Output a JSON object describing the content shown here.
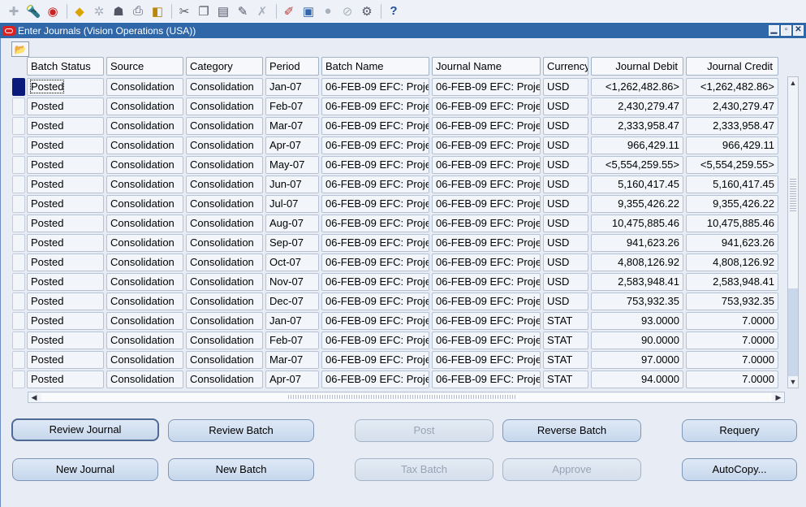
{
  "window": {
    "title": "Enter Journals (Vision Operations (USA))",
    "minimize_glyph": "▁",
    "maximize_glyph": "▫",
    "close_glyph": "✕"
  },
  "toolbar": {
    "icons": [
      "new-record-icon",
      "find-icon",
      "navigator-icon",
      "save-icon",
      "next-step-icon",
      "switch-responsibility-icon",
      "print-icon",
      "close-form-icon",
      "cut-icon",
      "copy-icon",
      "paste-icon",
      "clear-record-icon",
      "delete-record-icon",
      "edit-field-icon",
      "zoom-icon",
      "translations-icon",
      "attachments-icon",
      "folder-tools-icon",
      "help-icon"
    ]
  },
  "table": {
    "columns": [
      "Batch Status",
      "Source",
      "Category",
      "Period",
      "Batch Name",
      "Journal Name",
      "Currency",
      "Journal Debit",
      "Journal Credit"
    ],
    "rows": [
      [
        "Posted",
        "Consolidation",
        "Consolidation",
        "Jan-07",
        "06-FEB-09 EFC: Proje",
        "06-FEB-09 EFC: Proje",
        "USD",
        "<1,262,482.86>",
        "<1,262,482.86>"
      ],
      [
        "Posted",
        "Consolidation",
        "Consolidation",
        "Feb-07",
        "06-FEB-09 EFC: Proje",
        "06-FEB-09 EFC: Proje",
        "USD",
        "2,430,279.47",
        "2,430,279.47"
      ],
      [
        "Posted",
        "Consolidation",
        "Consolidation",
        "Mar-07",
        "06-FEB-09 EFC: Proje",
        "06-FEB-09 EFC: Proje",
        "USD",
        "2,333,958.47",
        "2,333,958.47"
      ],
      [
        "Posted",
        "Consolidation",
        "Consolidation",
        "Apr-07",
        "06-FEB-09 EFC: Proje",
        "06-FEB-09 EFC: Proje",
        "USD",
        "966,429.11",
        "966,429.11"
      ],
      [
        "Posted",
        "Consolidation",
        "Consolidation",
        "May-07",
        "06-FEB-09 EFC: Proje",
        "06-FEB-09 EFC: Proje",
        "USD",
        "<5,554,259.55>",
        "<5,554,259.55>"
      ],
      [
        "Posted",
        "Consolidation",
        "Consolidation",
        "Jun-07",
        "06-FEB-09 EFC: Proje",
        "06-FEB-09 EFC: Proje",
        "USD",
        "5,160,417.45",
        "5,160,417.45"
      ],
      [
        "Posted",
        "Consolidation",
        "Consolidation",
        "Jul-07",
        "06-FEB-09 EFC: Proje",
        "06-FEB-09 EFC: Proje",
        "USD",
        "9,355,426.22",
        "9,355,426.22"
      ],
      [
        "Posted",
        "Consolidation",
        "Consolidation",
        "Aug-07",
        "06-FEB-09 EFC: Proje",
        "06-FEB-09 EFC: Proje",
        "USD",
        "10,475,885.46",
        "10,475,885.46"
      ],
      [
        "Posted",
        "Consolidation",
        "Consolidation",
        "Sep-07",
        "06-FEB-09 EFC: Proje",
        "06-FEB-09 EFC: Proje",
        "USD",
        "941,623.26",
        "941,623.26"
      ],
      [
        "Posted",
        "Consolidation",
        "Consolidation",
        "Oct-07",
        "06-FEB-09 EFC: Proje",
        "06-FEB-09 EFC: Proje",
        "USD",
        "4,808,126.92",
        "4,808,126.92"
      ],
      [
        "Posted",
        "Consolidation",
        "Consolidation",
        "Nov-07",
        "06-FEB-09 EFC: Proje",
        "06-FEB-09 EFC: Proje",
        "USD",
        "2,583,948.41",
        "2,583,948.41"
      ],
      [
        "Posted",
        "Consolidation",
        "Consolidation",
        "Dec-07",
        "06-FEB-09 EFC: Proje",
        "06-FEB-09 EFC: Proje",
        "USD",
        "753,932.35",
        "753,932.35"
      ],
      [
        "Posted",
        "Consolidation",
        "Consolidation",
        "Jan-07",
        "06-FEB-09 EFC: Proje",
        "06-FEB-09 EFC: Proje",
        "STAT",
        "93.0000",
        "7.0000"
      ],
      [
        "Posted",
        "Consolidation",
        "Consolidation",
        "Feb-07",
        "06-FEB-09 EFC: Proje",
        "06-FEB-09 EFC: Proje",
        "STAT",
        "90.0000",
        "7.0000"
      ],
      [
        "Posted",
        "Consolidation",
        "Consolidation",
        "Mar-07",
        "06-FEB-09 EFC: Proje",
        "06-FEB-09 EFC: Proje",
        "STAT",
        "97.0000",
        "7.0000"
      ],
      [
        "Posted",
        "Consolidation",
        "Consolidation",
        "Apr-07",
        "06-FEB-09 EFC: Proje",
        "06-FEB-09 EFC: Proje",
        "STAT",
        "94.0000",
        "7.0000"
      ]
    ]
  },
  "buttons": {
    "review_journal": "Review Journal",
    "review_batch": "Review Batch",
    "post": "Post",
    "reverse_batch": "Reverse Batch",
    "requery": "Requery",
    "new_journal": "New Journal",
    "new_batch": "New Batch",
    "tax_batch": "Tax Batch",
    "approve": "Approve",
    "autocopy": "AutoCopy..."
  },
  "colors": {
    "title_bar": "#2f67a8",
    "window_bg": "#e8edf5",
    "active_row_marker": "#0a1a7a"
  }
}
